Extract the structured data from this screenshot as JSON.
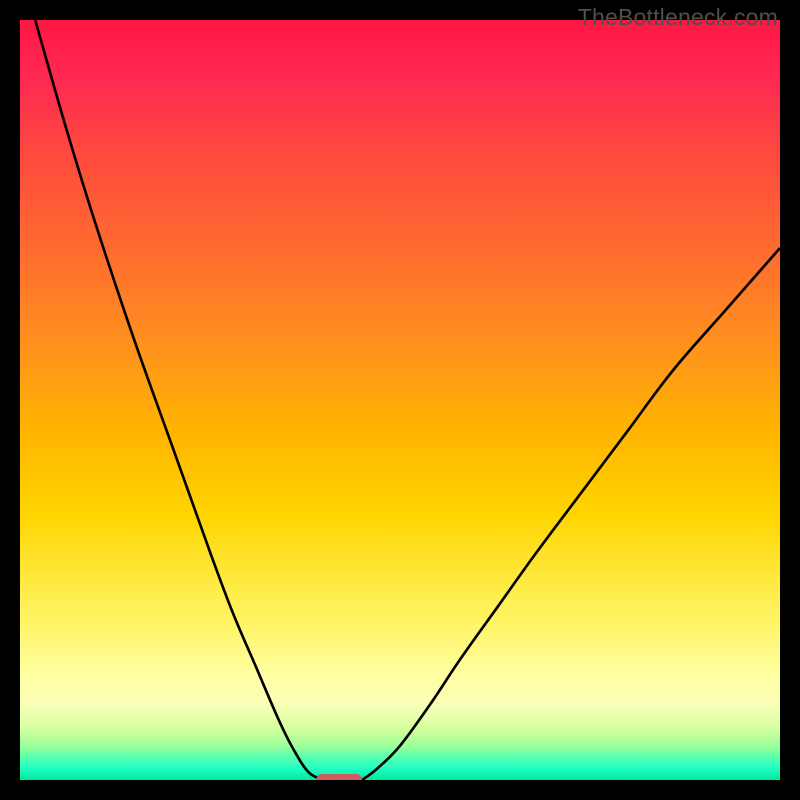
{
  "watermark": "TheBottleneck.com",
  "chart_data": {
    "type": "line",
    "title": "",
    "xlabel": "",
    "ylabel": "",
    "xlim": [
      0,
      100
    ],
    "ylim": [
      0,
      100
    ],
    "grid": false,
    "series": [
      {
        "name": "curve-left",
        "x": [
          2,
          6,
          10,
          15,
          20,
          25,
          28,
          31,
          34,
          36,
          38,
          40
        ],
        "y": [
          100,
          86,
          73,
          58,
          44,
          30,
          22,
          15,
          8,
          4,
          1,
          0
        ]
      },
      {
        "name": "curve-right",
        "x": [
          45,
          47,
          50,
          54,
          58,
          63,
          68,
          74,
          80,
          86,
          93,
          100
        ],
        "y": [
          0,
          1.5,
          4.5,
          10,
          16,
          23,
          30,
          38,
          46,
          54,
          62,
          70
        ]
      }
    ],
    "marker": {
      "x": 42,
      "width_pct": 6
    },
    "background_gradient": {
      "stops": [
        {
          "pct": 0,
          "color": "#ff1744"
        },
        {
          "pct": 18,
          "color": "#ff4b3e"
        },
        {
          "pct": 42,
          "color": "#ff8f1f"
        },
        {
          "pct": 65,
          "color": "#ffd400"
        },
        {
          "pct": 86,
          "color": "#fffea0"
        },
        {
          "pct": 95,
          "color": "#9dff9a"
        },
        {
          "pct": 100,
          "color": "#00e89e"
        }
      ]
    }
  }
}
